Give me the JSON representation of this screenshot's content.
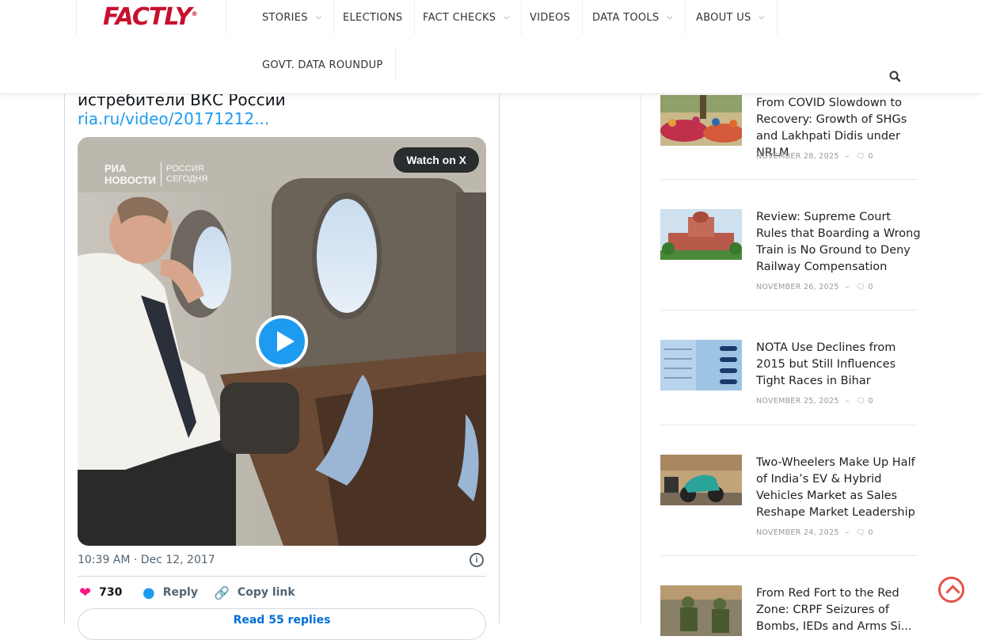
{
  "header": {
    "logo_text": "FACTLY",
    "nav": [
      {
        "label": "STORIES",
        "has_dropdown": true
      },
      {
        "label": "ELECTIONS",
        "has_dropdown": false
      },
      {
        "label": "FACT CHECKS",
        "has_dropdown": true
      },
      {
        "label": "VIDEOS",
        "has_dropdown": false
      },
      {
        "label": "DATA TOOLS",
        "has_dropdown": true
      },
      {
        "label": "ABOUT US",
        "has_dropdown": true
      },
      {
        "label": "GOVT. DATA ROUNDUP",
        "has_dropdown": false
      }
    ],
    "search_icon": "search-icon"
  },
  "tweet": {
    "text": "истребители ВКС России",
    "link": "ria.ru/video/20171212...",
    "watch_label": "Watch on X",
    "video_watermark_1": "РИА",
    "video_watermark_2": "НОВОСТИ",
    "video_watermark_3": "РОССИЯ",
    "video_watermark_4": "СЕГОДНЯ",
    "timestamp": "10:39 AM · Dec 12, 2017",
    "likes": "730",
    "reply_label": "Reply",
    "copy_label": "Copy link",
    "read_replies_label": "Read 55 replies"
  },
  "sidebar": {
    "posts": [
      {
        "title": "From COVID Slowdown to Recovery: Growth of SHGs and Lakhpati Didis under NRLM",
        "date": "NOVEMBER 28, 2025",
        "comments": "0"
      },
      {
        "title": "Review: Supreme Court Rules that Boarding a Wrong Train is No Ground to Deny Railway Compensation",
        "date": "NOVEMBER 26, 2025",
        "comments": "0"
      },
      {
        "title": "NOTA Use Declines from 2015 but Still Influences Tight Races in Bihar",
        "date": "NOVEMBER 25, 2025",
        "comments": "0"
      },
      {
        "title": "Two-Wheelers Make Up Half of India’s EV & Hybrid Vehicles Market as Sales Reshape Market Leadership",
        "date": "NOVEMBER 24, 2025",
        "comments": "0"
      },
      {
        "title": "From Red Fort to the Red Zone: CRPF Seizures of Bombs, IEDs and Arms Si...",
        "date": "",
        "comments": ""
      }
    ]
  },
  "colors": {
    "brand": "#c8102e",
    "twitter_blue": "#1d9bf0",
    "like_pink": "#f91880",
    "scroll_top": "#e4534a"
  }
}
